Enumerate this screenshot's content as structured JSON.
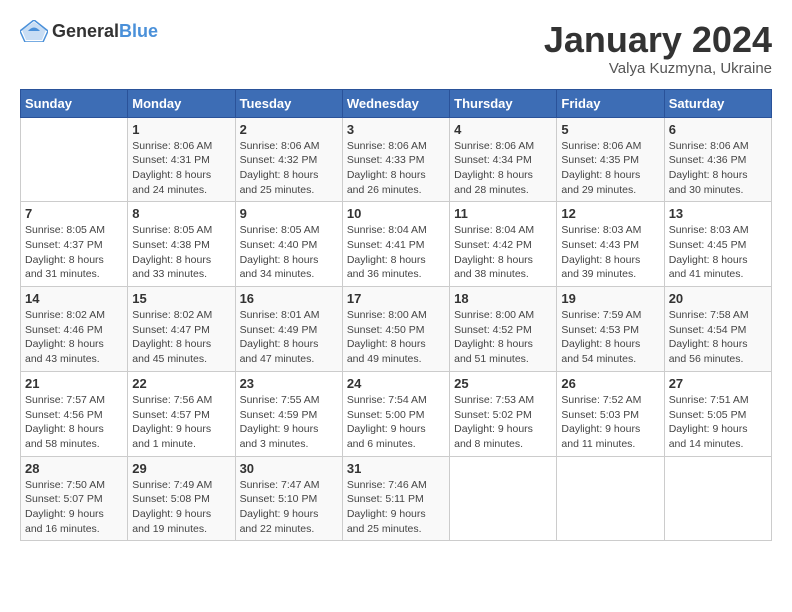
{
  "header": {
    "logo_general": "General",
    "logo_blue": "Blue",
    "month_title": "January 2024",
    "subtitle": "Valya Kuzmyna, Ukraine"
  },
  "weekdays": [
    "Sunday",
    "Monday",
    "Tuesday",
    "Wednesday",
    "Thursday",
    "Friday",
    "Saturday"
  ],
  "weeks": [
    [
      {
        "day": "",
        "info": ""
      },
      {
        "day": "1",
        "info": "Sunrise: 8:06 AM\nSunset: 4:31 PM\nDaylight: 8 hours\nand 24 minutes."
      },
      {
        "day": "2",
        "info": "Sunrise: 8:06 AM\nSunset: 4:32 PM\nDaylight: 8 hours\nand 25 minutes."
      },
      {
        "day": "3",
        "info": "Sunrise: 8:06 AM\nSunset: 4:33 PM\nDaylight: 8 hours\nand 26 minutes."
      },
      {
        "day": "4",
        "info": "Sunrise: 8:06 AM\nSunset: 4:34 PM\nDaylight: 8 hours\nand 28 minutes."
      },
      {
        "day": "5",
        "info": "Sunrise: 8:06 AM\nSunset: 4:35 PM\nDaylight: 8 hours\nand 29 minutes."
      },
      {
        "day": "6",
        "info": "Sunrise: 8:06 AM\nSunset: 4:36 PM\nDaylight: 8 hours\nand 30 minutes."
      }
    ],
    [
      {
        "day": "7",
        "info": "Sunrise: 8:05 AM\nSunset: 4:37 PM\nDaylight: 8 hours\nand 31 minutes."
      },
      {
        "day": "8",
        "info": "Sunrise: 8:05 AM\nSunset: 4:38 PM\nDaylight: 8 hours\nand 33 minutes."
      },
      {
        "day": "9",
        "info": "Sunrise: 8:05 AM\nSunset: 4:40 PM\nDaylight: 8 hours\nand 34 minutes."
      },
      {
        "day": "10",
        "info": "Sunrise: 8:04 AM\nSunset: 4:41 PM\nDaylight: 8 hours\nand 36 minutes."
      },
      {
        "day": "11",
        "info": "Sunrise: 8:04 AM\nSunset: 4:42 PM\nDaylight: 8 hours\nand 38 minutes."
      },
      {
        "day": "12",
        "info": "Sunrise: 8:03 AM\nSunset: 4:43 PM\nDaylight: 8 hours\nand 39 minutes."
      },
      {
        "day": "13",
        "info": "Sunrise: 8:03 AM\nSunset: 4:45 PM\nDaylight: 8 hours\nand 41 minutes."
      }
    ],
    [
      {
        "day": "14",
        "info": "Sunrise: 8:02 AM\nSunset: 4:46 PM\nDaylight: 8 hours\nand 43 minutes."
      },
      {
        "day": "15",
        "info": "Sunrise: 8:02 AM\nSunset: 4:47 PM\nDaylight: 8 hours\nand 45 minutes."
      },
      {
        "day": "16",
        "info": "Sunrise: 8:01 AM\nSunset: 4:49 PM\nDaylight: 8 hours\nand 47 minutes."
      },
      {
        "day": "17",
        "info": "Sunrise: 8:00 AM\nSunset: 4:50 PM\nDaylight: 8 hours\nand 49 minutes."
      },
      {
        "day": "18",
        "info": "Sunrise: 8:00 AM\nSunset: 4:52 PM\nDaylight: 8 hours\nand 51 minutes."
      },
      {
        "day": "19",
        "info": "Sunrise: 7:59 AM\nSunset: 4:53 PM\nDaylight: 8 hours\nand 54 minutes."
      },
      {
        "day": "20",
        "info": "Sunrise: 7:58 AM\nSunset: 4:54 PM\nDaylight: 8 hours\nand 56 minutes."
      }
    ],
    [
      {
        "day": "21",
        "info": "Sunrise: 7:57 AM\nSunset: 4:56 PM\nDaylight: 8 hours\nand 58 minutes."
      },
      {
        "day": "22",
        "info": "Sunrise: 7:56 AM\nSunset: 4:57 PM\nDaylight: 9 hours\nand 1 minute."
      },
      {
        "day": "23",
        "info": "Sunrise: 7:55 AM\nSunset: 4:59 PM\nDaylight: 9 hours\nand 3 minutes."
      },
      {
        "day": "24",
        "info": "Sunrise: 7:54 AM\nSunset: 5:00 PM\nDaylight: 9 hours\nand 6 minutes."
      },
      {
        "day": "25",
        "info": "Sunrise: 7:53 AM\nSunset: 5:02 PM\nDaylight: 9 hours\nand 8 minutes."
      },
      {
        "day": "26",
        "info": "Sunrise: 7:52 AM\nSunset: 5:03 PM\nDaylight: 9 hours\nand 11 minutes."
      },
      {
        "day": "27",
        "info": "Sunrise: 7:51 AM\nSunset: 5:05 PM\nDaylight: 9 hours\nand 14 minutes."
      }
    ],
    [
      {
        "day": "28",
        "info": "Sunrise: 7:50 AM\nSunset: 5:07 PM\nDaylight: 9 hours\nand 16 minutes."
      },
      {
        "day": "29",
        "info": "Sunrise: 7:49 AM\nSunset: 5:08 PM\nDaylight: 9 hours\nand 19 minutes."
      },
      {
        "day": "30",
        "info": "Sunrise: 7:47 AM\nSunset: 5:10 PM\nDaylight: 9 hours\nand 22 minutes."
      },
      {
        "day": "31",
        "info": "Sunrise: 7:46 AM\nSunset: 5:11 PM\nDaylight: 9 hours\nand 25 minutes."
      },
      {
        "day": "",
        "info": ""
      },
      {
        "day": "",
        "info": ""
      },
      {
        "day": "",
        "info": ""
      }
    ]
  ]
}
